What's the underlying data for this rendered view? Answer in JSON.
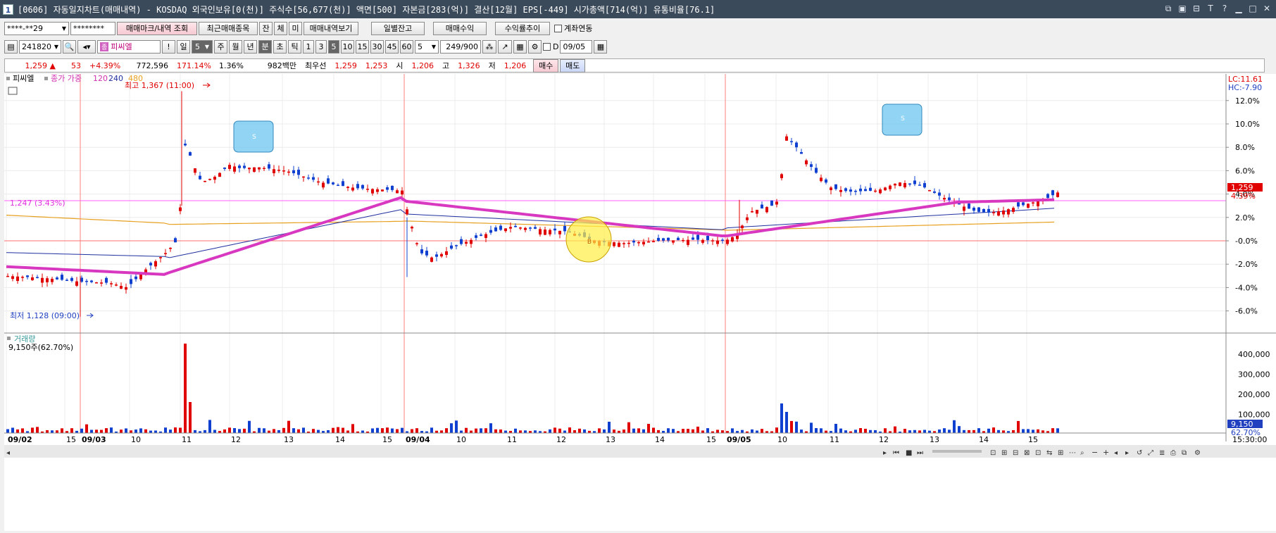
{
  "window": {
    "number": "1",
    "title": "[0606] 자동일지차트(매매내역) - KOSDAQ 외국인보유[0(천)] 주식수[56,677(천)] 액면[500] 자본금[283(억)] 결산[12월] EPS[-449] 시가총액[714(억)] 유통비율[76.1]"
  },
  "toolbar1": {
    "account": "****-**29",
    "password": "********",
    "btn_mark": "매매마크/내역 조회",
    "btn_recent": "최근매매종목",
    "btn_jan": "잔",
    "btn_che": "체",
    "btn_mi": "미",
    "btn_history": "매매내역보기",
    "btn_daily": "일별잔고",
    "btn_profit": "매매수익",
    "btn_rate": "수익률추이",
    "link_label": "계좌연동"
  },
  "toolbar2": {
    "code": "241820",
    "name": "피씨엘",
    "p_il": "일",
    "p_5": "5",
    "p_ju": "주",
    "p_wol": "월",
    "p_nyeon": "년",
    "p_bun": "분",
    "p_cho": "초",
    "p_tick": "틱",
    "intervals": [
      "1",
      "3",
      "5",
      "10",
      "15",
      "30",
      "45",
      "60"
    ],
    "count_value": "5",
    "range": "249/900",
    "d_label": "D",
    "date": "09/05"
  },
  "quote": {
    "price": "1,259",
    "change": "53",
    "pct": "+4.39%",
    "volume": "772,596",
    "vol_ratio": "171.14%",
    "turnover": "1.36%",
    "amount": "982백만",
    "best_label": "최우선",
    "best_ask": "1,259",
    "best_bid": "1,253",
    "open_label": "시",
    "open": "1,206",
    "high_label": "고",
    "high": "1,326",
    "low_label": "저",
    "low": "1,206",
    "buy": "매수",
    "sell": "매도"
  },
  "chart": {
    "name_label": "피씨엘",
    "legend_label": "종가 가중",
    "ma120": "120",
    "ma240": "240",
    "ma480": "480",
    "lc": "LC:11.61",
    "hc": "HC:-7.90",
    "high_note": "최고 1,367 (11:00)",
    "low_note": "최저 1,128 (09:00)",
    "ref_label": "1,247 (3.43%)",
    "price_tag": "1,259",
    "pct_tag": "4.39%",
    "y_ticks": [
      "12.0%",
      "10.0%",
      "8.0%",
      "6.0%",
      "4.0%",
      "2.0%",
      "-0.0%",
      "-2.0%",
      "-4.0%",
      "-6.0%"
    ],
    "vol_label": "거래량",
    "vol_value": "9,150주(62.70%)",
    "vol_ticks": [
      "400,000",
      "300,000",
      "200,000",
      "100,000"
    ],
    "vol_tag": "9,150",
    "vol_pct_tag": "62.70%",
    "x_labels": [
      [
        "09/02",
        0
      ],
      [
        "15",
        1
      ],
      [
        "09/03",
        1
      ],
      [
        "10",
        1
      ],
      [
        "11",
        1
      ],
      [
        "12",
        1
      ],
      [
        "13",
        1
      ],
      [
        "14",
        1
      ],
      [
        "15",
        1
      ],
      [
        "09/04",
        1
      ],
      [
        "10",
        1
      ],
      [
        "11",
        1
      ],
      [
        "12",
        1
      ],
      [
        "13",
        1
      ],
      [
        "14",
        1
      ],
      [
        "15",
        1
      ],
      [
        "09/05",
        1
      ],
      [
        "10",
        1
      ],
      [
        "11",
        1
      ],
      [
        "12",
        1
      ],
      [
        "13",
        1
      ],
      [
        "14",
        1
      ],
      [
        "15",
        1
      ]
    ],
    "time_label": "15:30:00",
    "sell_marker": "S",
    "buy_marker": "B"
  },
  "colors": {
    "up": "#e00000",
    "down": "#0040cc",
    "weighted": "#e040c0",
    "ma120": "#2030a0",
    "ma240": "#e8a020",
    "ref": "#ff40ff",
    "title_bg": "#3b4a5a"
  }
}
